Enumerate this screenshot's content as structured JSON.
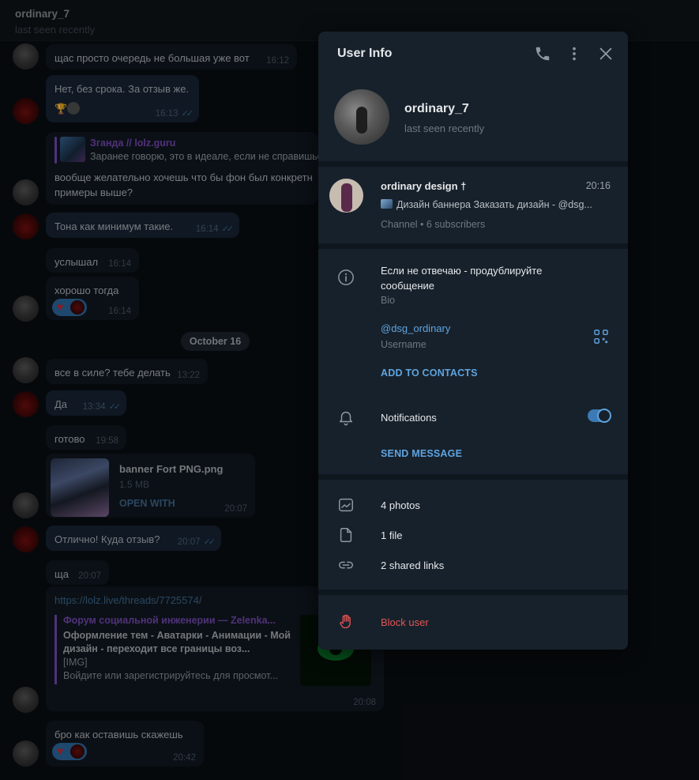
{
  "chat_header": {
    "name": "ordinary_7",
    "status": "last seen recently"
  },
  "messages": [
    {
      "id": "m1",
      "text": "щас просто очередь не большая уже вот",
      "time": "16:12",
      "direction": "in"
    },
    {
      "id": "m2",
      "text": "Нет, без срока. За отзыв же.",
      "time": "16:13",
      "direction": "out",
      "read": true
    },
    {
      "id": "m3",
      "reply_name": "Зганда // lolz.guru",
      "reply_text": "Заранее говорю, это в идеале, если не справишься",
      "text_line1": "вообще желательно хочешь что бы фон был конкретн",
      "text_line2": "примеры выше?",
      "direction": "in"
    },
    {
      "id": "m4",
      "text": "Тона как минимум такие.",
      "time": "16:14",
      "direction": "out",
      "read": true
    },
    {
      "id": "m5",
      "text": "услышал",
      "time": "16:14",
      "direction": "in"
    },
    {
      "id": "m6",
      "text": "хорошо тогда",
      "time": "16:14",
      "direction": "in",
      "reaction": "heart"
    },
    {
      "id": "m7",
      "text": "все в силе? тебе делать",
      "time": "13:22",
      "direction": "in"
    },
    {
      "id": "m8",
      "text": "Да",
      "time": "13:34",
      "direction": "out",
      "read": true
    },
    {
      "id": "m9",
      "text": "готово",
      "time": "19:58",
      "direction": "in"
    },
    {
      "id": "m10",
      "file_name": "banner Fort PNG.png",
      "file_size": "1.5 MB",
      "action": "OPEN WITH",
      "time": "20:07",
      "direction": "in"
    },
    {
      "id": "m11",
      "text": "Отлично! Куда отзыв?",
      "time": "20:07",
      "direction": "out",
      "read": true
    },
    {
      "id": "m12",
      "text": "ща",
      "time": "20:07",
      "direction": "in"
    },
    {
      "id": "m13",
      "url": "https://lolz.live/threads/7725574/",
      "site": "Форум социальной инженерии — Zelenka...",
      "title": "Оформление тем - Аватарки - Анимации - Мой дизайн - переходит все границы воз...",
      "desc_line1": "[IMG]",
      "desc_line2": "Войдите или зарегистрируйтесь для просмот...",
      "time": "20:08",
      "direction": "in"
    },
    {
      "id": "m14",
      "text": "бро как оставишь скажешь",
      "time": "20:42",
      "direction": "in",
      "reaction": "heart"
    }
  ],
  "date_divider": "October 16",
  "user_info": {
    "title": "User Info",
    "header_icons": [
      "phone-icon",
      "more-vertical-icon",
      "close-icon"
    ],
    "profile": {
      "name": "ordinary_7",
      "status": "last seen recently"
    },
    "channel": {
      "name": "ordinary design †",
      "time": "20:16",
      "last_message": "Дизайн баннера  Заказать дизайн - @dsg...",
      "subtitle": "Channel • 6 subscribers"
    },
    "bio": {
      "text_line1": "Если не отвечаю - продублируйте",
      "text_line2": "сообщение",
      "label": "Bio"
    },
    "username": {
      "value": "@dsg_ordinary",
      "label": "Username"
    },
    "add_to_contacts": "ADD TO CONTACTS",
    "notifications": {
      "label": "Notifications",
      "enabled": true
    },
    "send_message": "SEND MESSAGE",
    "media": {
      "photos": "4 photos",
      "files": "1 file",
      "links": "2 shared links"
    },
    "block": "Block user"
  },
  "colors": {
    "accent": "#5fa4e0",
    "danger": "#e25454",
    "panel_bg": "#17212b",
    "chat_bg": "#0a0e13"
  }
}
